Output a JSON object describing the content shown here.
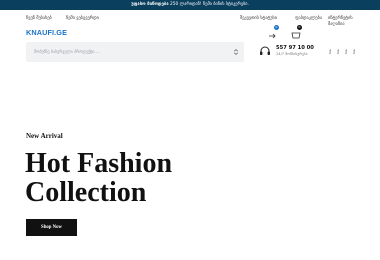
{
  "promo": {
    "text": "უფასო მიწოდება 250 ლარიდან! ჩემი ბინის სტიკერები.",
    "text_bold": "უფასო მიწოდება",
    "text_rest": "250 ლარიდან! ჩემი ბინის სტიკერები."
  },
  "header": {
    "nav_left": [
      "ჩვენ შესახებ",
      "ჩემი ვებგვერდი"
    ],
    "nav_right": [
      "შეკვეთის სტატუსი",
      "ფასდაკლება",
      "ინტერნეტის მაღაზია"
    ],
    "logo": "KNAUFI.GE"
  },
  "search": {
    "placeholder": "მოძებნე სასურველი პროდუქტი.....",
    "icon": "chevron-down-icon"
  },
  "actions": {
    "compare_count": "0",
    "cart_count": "0",
    "accent_color": "#1a73c9"
  },
  "contact": {
    "phone": "557 97 10 00",
    "hours": "24/7 მომსახურება",
    "icon": "headset-icon"
  },
  "languages": [
    "ქ",
    "ქ",
    "ქ",
    "ქ"
  ],
  "hero": {
    "kicker": "New Arrival",
    "title_line1": "Hot Fashion",
    "title_line2": "Collection",
    "button": "Shop Now"
  }
}
